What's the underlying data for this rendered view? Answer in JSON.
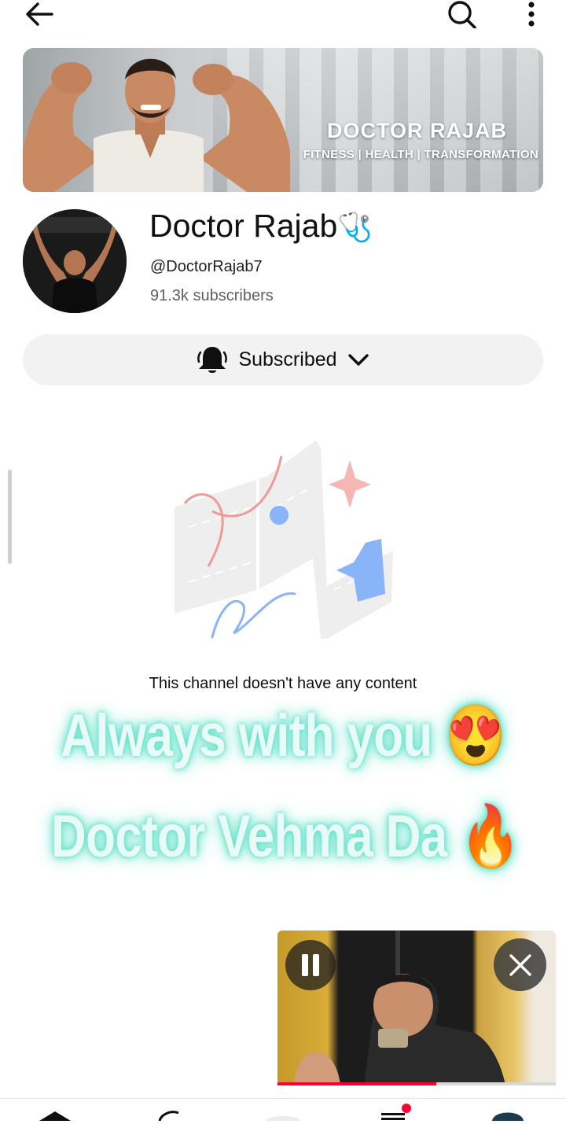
{
  "topbar": {
    "back_icon": "arrow-left-icon",
    "search_icon": "search-icon",
    "more_icon": "more-vert-icon"
  },
  "banner": {
    "title": "DOCTOR RAJAB",
    "subtitle": "FITNESS | HEALTH | TRANSFORMATION"
  },
  "channel": {
    "name": "Doctor Rajab",
    "name_emoji": "🩺",
    "handle": "@DoctorRajab7",
    "subscribers": "91.3k subscribers"
  },
  "subscribe": {
    "label": "Subscribed",
    "bell_icon": "bell-icon",
    "chevron_icon": "chevron-down-icon"
  },
  "empty_state": {
    "message": "This channel doesn't have any content"
  },
  "overlay": {
    "line1": "Always with you 😍",
    "line2": "Doctor Vehma Da 🔥"
  },
  "mini_player": {
    "pause_icon": "pause-icon",
    "close_icon": "close-icon",
    "progress": 0.57,
    "progress_color": "#ff0033"
  },
  "bottom_nav": {
    "items": [
      "home-icon",
      "shorts-icon",
      "create-icon",
      "subscriptions-icon",
      "profile-avatar"
    ]
  },
  "colors": {
    "button_bg": "#f2f2f2",
    "glow": "#5fe0c8",
    "accent_red": "#ff0033"
  }
}
